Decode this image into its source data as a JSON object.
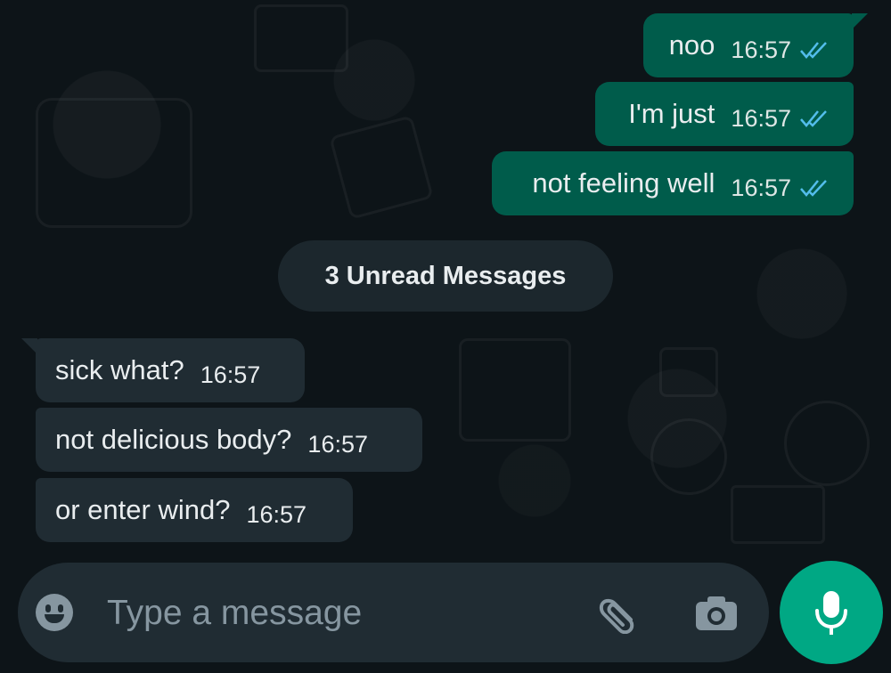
{
  "outgoing": [
    {
      "text": "noo",
      "time": "16:57"
    },
    {
      "text": "I'm just",
      "time": "16:57"
    },
    {
      "text": "not feeling well",
      "time": "16:57"
    }
  ],
  "unread_label": "3 Unread Messages",
  "incoming": [
    {
      "text": "sick what?",
      "time": "16:57"
    },
    {
      "text": "not delicious body?",
      "time": "16:57"
    },
    {
      "text": "or enter wind?",
      "time": "16:57"
    }
  ],
  "composer": {
    "placeholder": "Type a message",
    "icons": {
      "emoji": "emoji-icon",
      "attach": "paperclip-icon",
      "camera": "camera-icon",
      "mic": "microphone-icon"
    }
  },
  "colors": {
    "outgoing_bubble": "#005c4b",
    "incoming_bubble": "#202c33",
    "accent": "#00a884",
    "read_ticks": "#53bdeb"
  }
}
